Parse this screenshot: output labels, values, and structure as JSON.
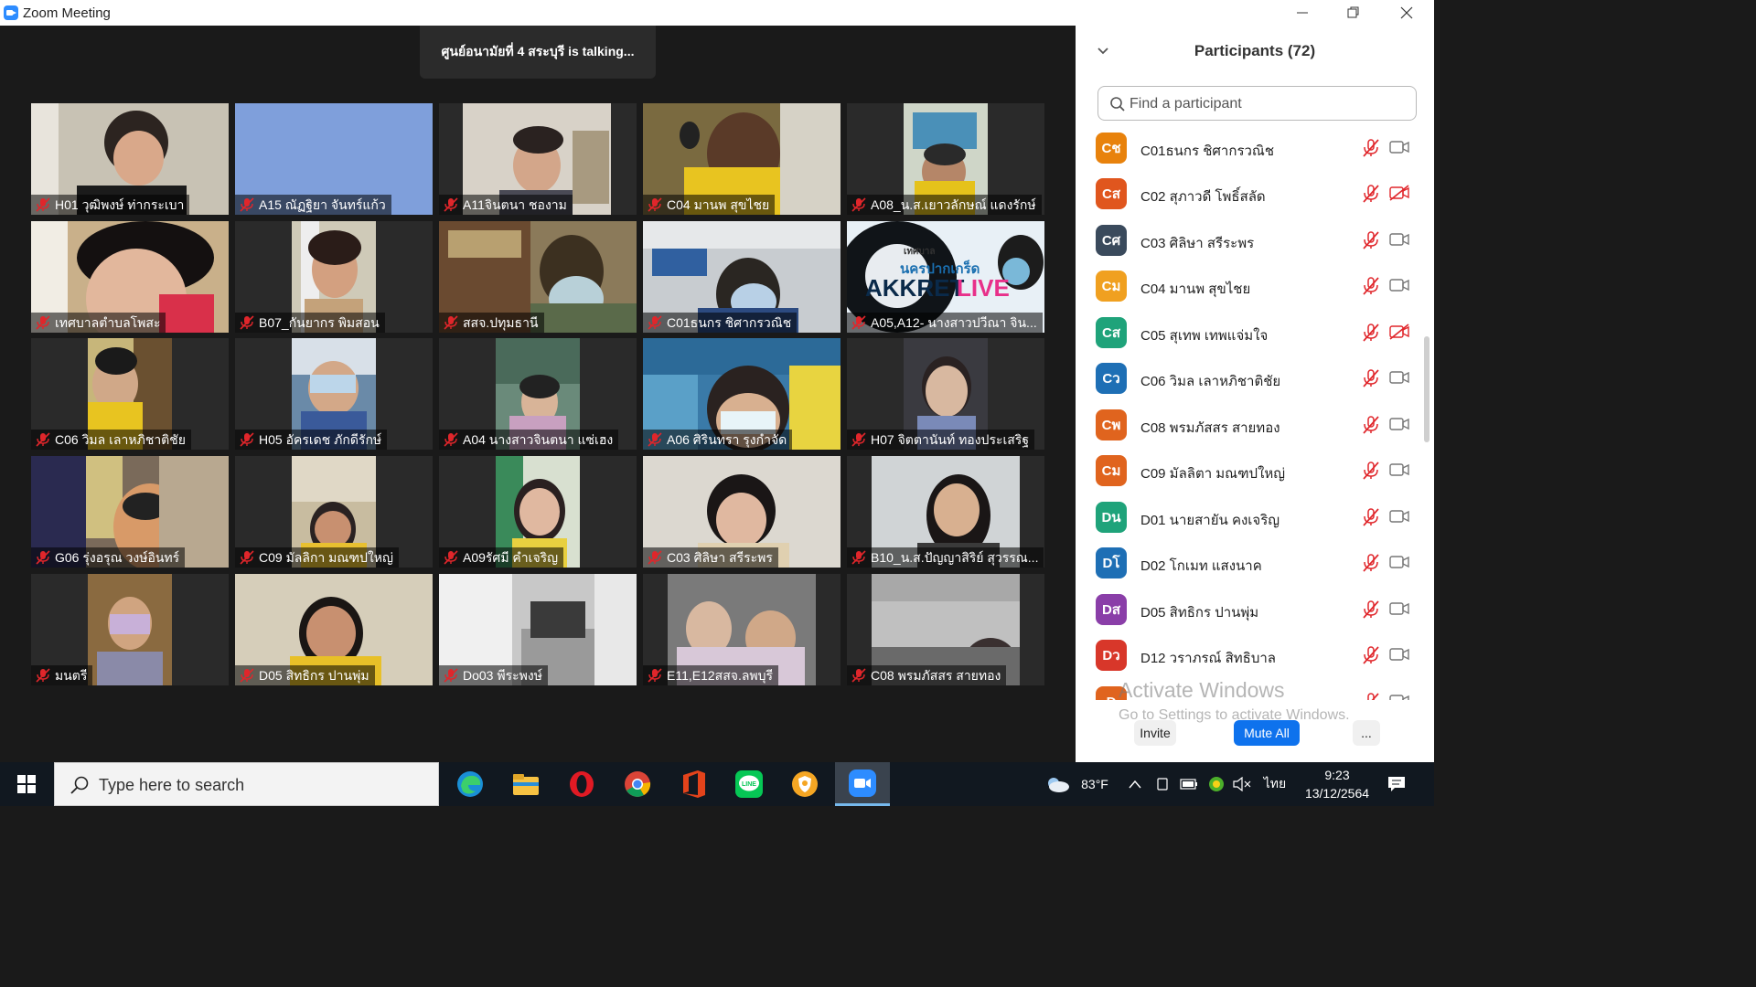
{
  "window": {
    "title": "Zoom Meeting"
  },
  "meeting": {
    "talking_banner": "ศูนย์อนามัยที่ 4 สระบุรี is talking..."
  },
  "tiles": [
    {
      "label": "H01 วุฒิพงษ์ ท่ากระเบา"
    },
    {
      "label": "A15 ณัฏฐิยา จันทร์แก้ว"
    },
    {
      "label": "A11จินตนา ชองาม"
    },
    {
      "label": "C04 มานพ สุขไชย"
    },
    {
      "label": "A08_น.ส.เยาวลักษณ์ แดงรักษ์"
    },
    {
      "label": "เทศบาลตำบลโพสะ"
    },
    {
      "label": "B07_กันยากร พิมสอน"
    },
    {
      "label": "สสจ.ปทุมธานี"
    },
    {
      "label": "C01ธนกร ชิศากรวณิช"
    },
    {
      "label": "A05,A12- นางสาวปวีณา จิน..."
    },
    {
      "label": "C06 วิมล เลาหภิชาติชัย"
    },
    {
      "label": "H05 อัครเดช ภักดีรักษ์"
    },
    {
      "label": "A04 นางสาวจินตนา แซ่เฮง"
    },
    {
      "label": "A06 ศิรินทรา รุงกำจัด"
    },
    {
      "label": "H07 จิตตานันท์ ทองประเสริฐ"
    },
    {
      "label": "G06 รุ่งอรุณ วงษ์อินทร์"
    },
    {
      "label": "C09 มัลลิกา มณฑปใหญ่"
    },
    {
      "label": "A09รัศมี คำเจริญ"
    },
    {
      "label": "C03 ศิลิษา สรีระพร"
    },
    {
      "label": "B10_น.ส.ปัญญาสิริย์ สุวรรณ..."
    },
    {
      "label": "มนตรี"
    },
    {
      "label": "D05 สิทธิกร ปานพุ่ม"
    },
    {
      "label": "Do03 พีระพงษ์"
    },
    {
      "label": "E11,E12สสจ.ลพบุรี"
    },
    {
      "label": "C08 พรมภัสสร สายทอง"
    }
  ],
  "tile_banner_text": {
    "line1": "เทศบาล",
    "line2": "นครปากเกร็ด",
    "line3": "AKKRET",
    "line4": "LIVE"
  },
  "participants_panel": {
    "title": "Participants (72)",
    "search_placeholder": "Find a participant",
    "participants": [
      {
        "initials": "Cช",
        "name": "C01ธนกร ชิศากรวณิช",
        "color": "#e8820c",
        "video_off": false
      },
      {
        "initials": "Cส",
        "name": "C02 สุภาวดี โพธิ์สลัด",
        "color": "#e0561e",
        "video_off": true
      },
      {
        "initials": "Cศ",
        "name": "C03 ศิลิษา  สรีระพร",
        "color": "#3a4a5c",
        "video_off": false
      },
      {
        "initials": "Cม",
        "name": "C04 มานพ สุขไชย",
        "color": "#f0a020",
        "video_off": false
      },
      {
        "initials": "Cส",
        "name": "C05 สุเทพ เทพแจ่มใจ",
        "color": "#1fa37a",
        "video_off": true
      },
      {
        "initials": "Cว",
        "name": "C06 วิมล เลาหภิชาติชัย",
        "color": "#1e6fb5",
        "video_off": false
      },
      {
        "initials": "Cพ",
        "name": "C08 พรมภัสสร สายทอง",
        "color": "#e0641e",
        "video_off": false
      },
      {
        "initials": "Cม",
        "name": "C09 มัลลิตา มณฑปใหญ่",
        "color": "#e0641e",
        "video_off": false
      },
      {
        "initials": "Dน",
        "name": "D01 นายสายัน  คงเจริญ",
        "color": "#1fa37a",
        "video_off": false
      },
      {
        "initials": "Dโ",
        "name": "D02 โกเมท แสงนาค",
        "color": "#1e6fb5",
        "video_off": false
      },
      {
        "initials": "Dส",
        "name": "D05 สิทธิกร  ปานพุ่ม",
        "color": "#8a3ea8",
        "video_off": false
      },
      {
        "initials": "Dว",
        "name": "D12 วราภรณ์ สิทธิบาล",
        "color": "#d8372a",
        "video_off": false
      },
      {
        "initials": "D",
        "name": "",
        "color": "#e0641e",
        "video_off": false
      }
    ],
    "buttons": {
      "invite": "Invite",
      "mute_all": "Mute All",
      "more": "..."
    }
  },
  "watermark": {
    "line1": "Activate Windows",
    "line2": "Go to Settings to activate Windows."
  },
  "taskbar": {
    "search_placeholder": "Type here to search",
    "weather": "83°F",
    "language": "ไทย",
    "time": "9:23",
    "date": "13/12/2564"
  }
}
